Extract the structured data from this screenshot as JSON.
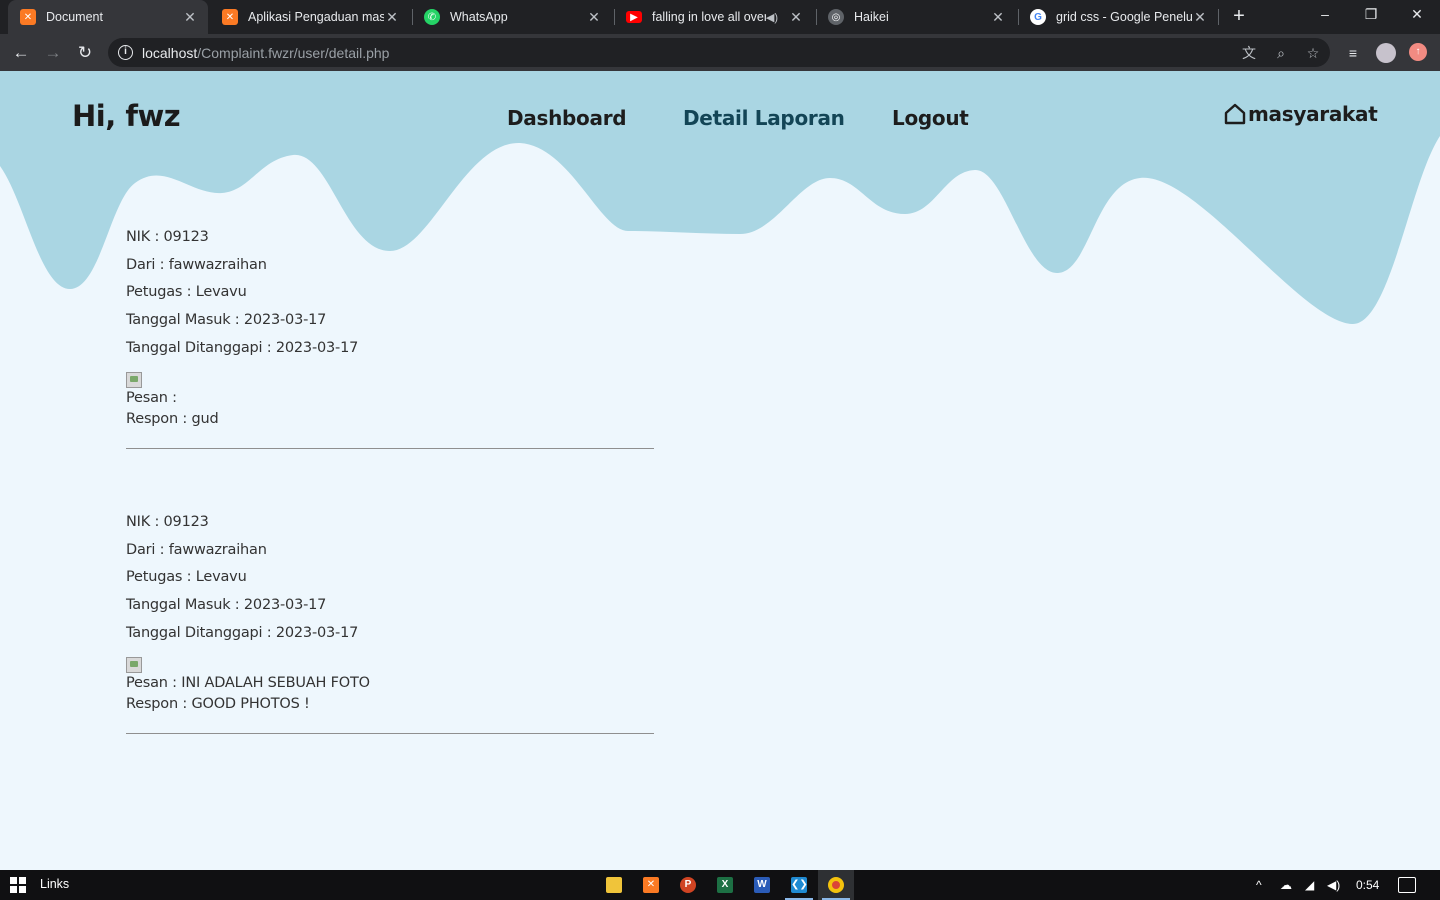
{
  "browser": {
    "tabs": [
      {
        "title": "Document",
        "favicon": "xampp-icon",
        "active": true
      },
      {
        "title": "Aplikasi Pengaduan masyarakat",
        "favicon": "xampp-icon",
        "active": false
      },
      {
        "title": "WhatsApp",
        "favicon": "whatsapp-icon",
        "active": false
      },
      {
        "title": "falling in love all over",
        "favicon": "youtube-icon",
        "active": false,
        "audio": true
      },
      {
        "title": "Haikei",
        "favicon": "globe-icon",
        "active": false
      },
      {
        "title": "grid css - Google Penelusuran",
        "favicon": "google-icon",
        "active": false
      }
    ],
    "url_host": "localhost",
    "url_path": "/Complaint.fwzr/user/detail.php"
  },
  "header": {
    "greeting": "Hi, fwz",
    "nav": [
      "Dashboard",
      "Detail Laporan",
      "Logout"
    ],
    "brand": "masyarakat",
    "wave_color": "#aad6e3",
    "background": "#eef7fd"
  },
  "reports": [
    {
      "nik": "NIK : 09123",
      "dari": "Dari : fawwazraihan",
      "petugas": "Petugas : Levavu",
      "tanggal_masuk": "Tanggal Masuk : 2023-03-17",
      "tanggal_ditanggapi": "Tanggal Ditanggapi : 2023-03-17",
      "pesan": "Pesan :",
      "respon": "Respon : gud"
    },
    {
      "nik": "NIK : 09123",
      "dari": "Dari : fawwazraihan",
      "petugas": "Petugas : Levavu",
      "tanggal_masuk": "Tanggal Masuk : 2023-03-17",
      "tanggal_ditanggapi": "Tanggal Ditanggapi : 2023-03-17",
      "pesan": "Pesan : INI ADALAH SEBUAH FOTO",
      "respon": "Respon : GOOD PHOTOS !"
    }
  ],
  "taskbar": {
    "links_label": "Links",
    "clock": "0:54",
    "apps": [
      "file-explorer-icon",
      "xampp-icon",
      "powerpoint-icon",
      "excel-icon",
      "word-icon",
      "vscode-icon",
      "chrome-icon"
    ]
  }
}
